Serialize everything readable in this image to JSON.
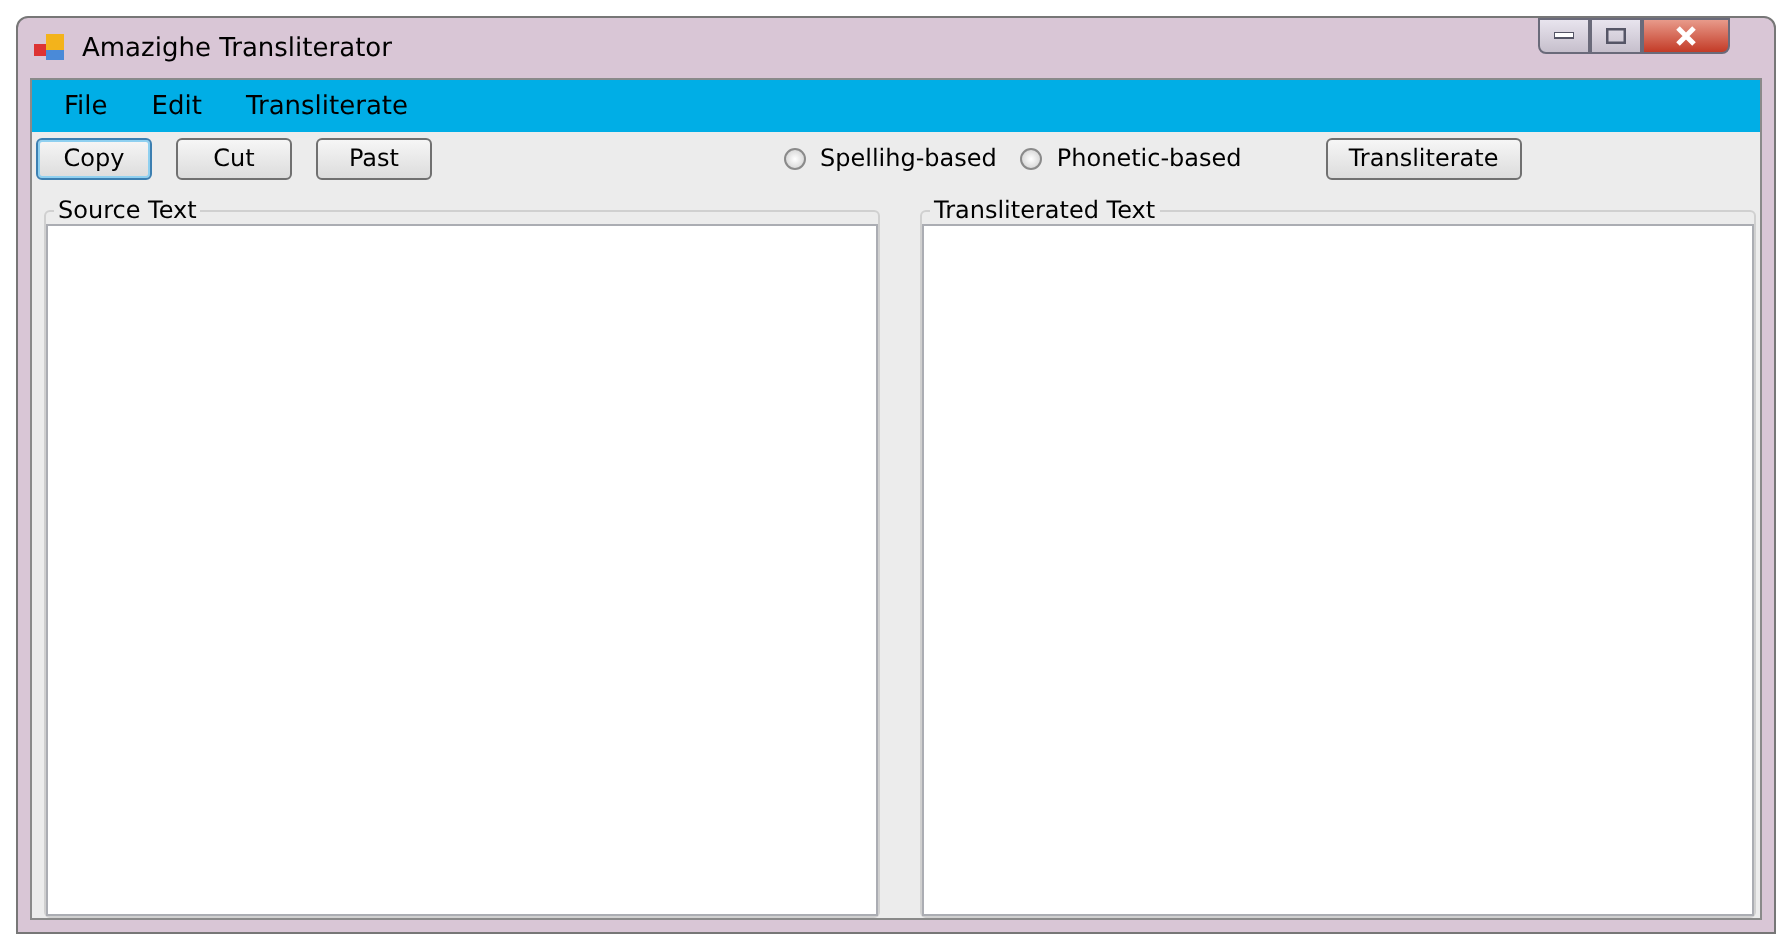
{
  "window": {
    "title": "Amazighe Transliterator"
  },
  "menu": [
    "File",
    "Edit",
    "Transliterate"
  ],
  "toolbar_buttons": [
    {
      "label": "Copy",
      "focused": true
    },
    {
      "label": "Cut",
      "focused": false
    },
    {
      "label": "Past",
      "focused": false
    }
  ],
  "modes": [
    {
      "label": "Spellihg-based",
      "selected": false
    },
    {
      "label": "Phonetic-based",
      "selected": false
    }
  ],
  "action_button": {
    "label": "Transliterate"
  },
  "panels": [
    {
      "title": "Source Text"
    },
    {
      "title": "Transliterated Text"
    }
  ]
}
